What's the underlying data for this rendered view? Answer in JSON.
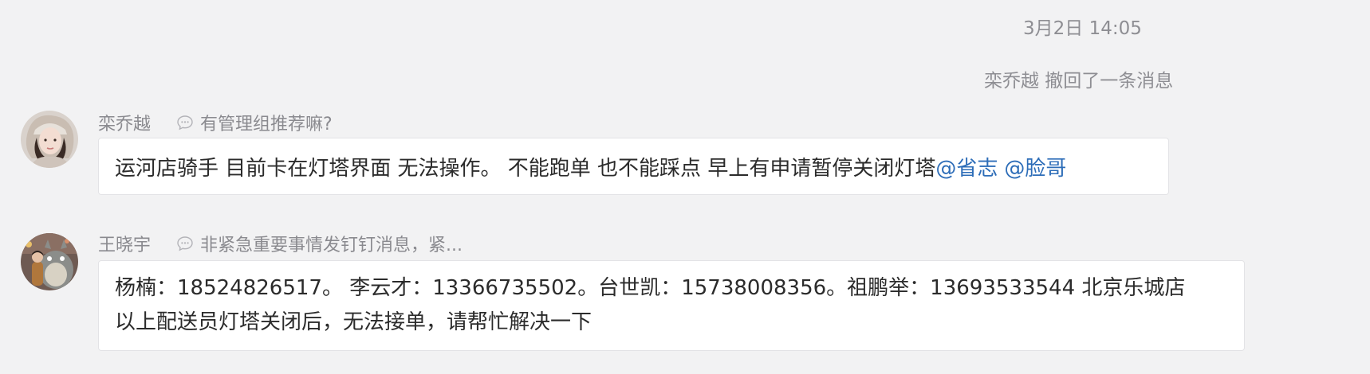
{
  "timestamp": "3月2日 14:05",
  "recall_notice": "栾乔越 撤回了一条消息",
  "messages": [
    {
      "sender": "栾乔越",
      "reply_to": "有管理组推荐嘛?",
      "text": "运河店骑手 目前卡在灯塔界面  无法操作。  不能跑单 也不能踩点  早上有申请暂停关闭灯塔",
      "mentions": [
        "@省志",
        "@脸哥"
      ]
    },
    {
      "sender": "王晓宇",
      "reply_to": "非紧急重要事情发钉钉消息，紧...",
      "lines": [
        "杨楠：18524826517。 李云才：13366735502。台世凯：15738008356。祖鹏举：13693533544 北京乐城店",
        "以上配送员灯塔关闭后，无法接单，请帮忙解决一下"
      ]
    }
  ],
  "colors": {
    "background": "#f2f2f3",
    "bubble": "#ffffff",
    "mention": "#2d6db8",
    "meta_text": "#8e8e93"
  },
  "icons": {
    "reply": "speech-bubble-icon"
  }
}
